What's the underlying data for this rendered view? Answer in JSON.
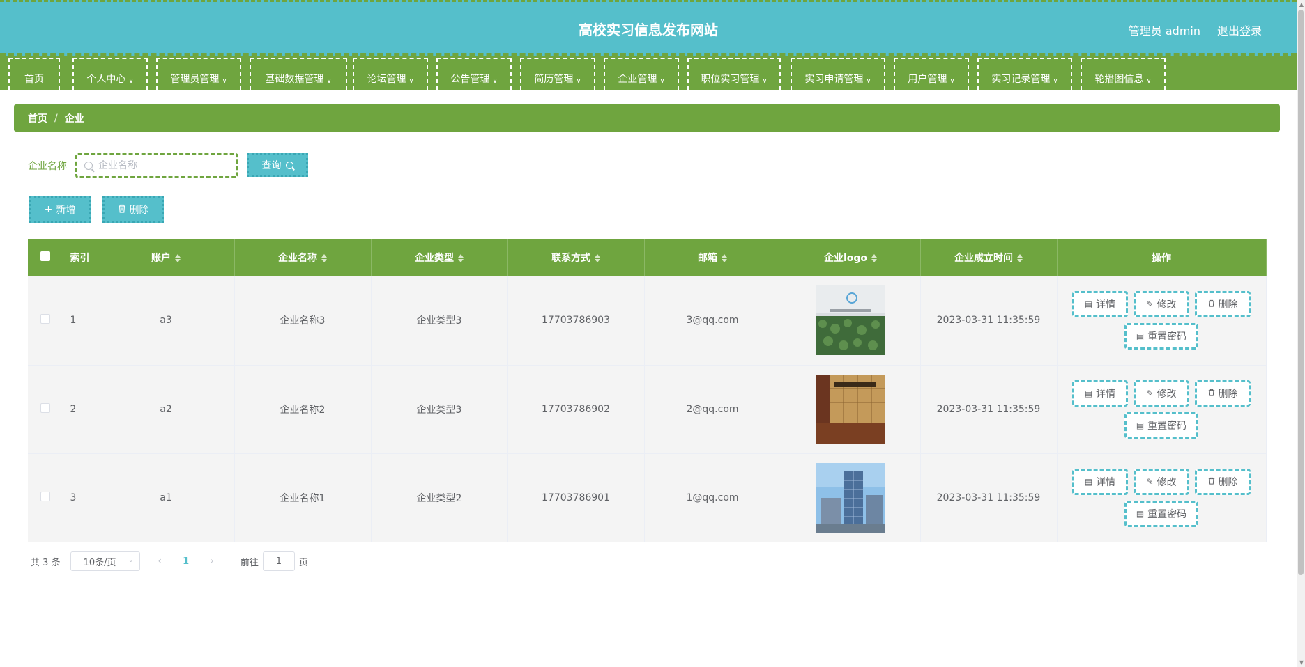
{
  "header": {
    "title": "高校实习信息发布网站",
    "admin_label": "管理员 admin",
    "logout_label": "退出登录",
    "bg_color": "#55bfcb",
    "accent_color": "#6fa53f"
  },
  "nav": {
    "items": [
      {
        "label": "首页",
        "has_dropdown": false
      },
      {
        "label": "个人中心",
        "has_dropdown": true
      },
      {
        "label": "管理员管理",
        "has_dropdown": true
      },
      {
        "label": "基础数据管理",
        "has_dropdown": true
      },
      {
        "label": "论坛管理",
        "has_dropdown": true
      },
      {
        "label": "公告管理",
        "has_dropdown": true
      },
      {
        "label": "简历管理",
        "has_dropdown": true
      },
      {
        "label": "企业管理",
        "has_dropdown": true
      },
      {
        "label": "职位实习管理",
        "has_dropdown": true
      },
      {
        "label": "实习申请管理",
        "has_dropdown": true
      },
      {
        "label": "用户管理",
        "has_dropdown": true
      },
      {
        "label": "实习记录管理",
        "has_dropdown": true
      },
      {
        "label": "轮播图信息",
        "has_dropdown": true
      }
    ]
  },
  "breadcrumb": {
    "home": "首页",
    "separator": "/",
    "current": "企业"
  },
  "search": {
    "label": "企业名称",
    "placeholder": "企业名称",
    "value": "",
    "query_label": "查询"
  },
  "toolbar": {
    "add_label": "新增",
    "delete_label": "删除"
  },
  "table": {
    "headers": {
      "index": "索引",
      "account": "账户",
      "name": "企业名称",
      "type": "企业类型",
      "phone": "联系方式",
      "email": "邮箱",
      "logo": "企业logo",
      "founded": "企业成立时间",
      "actions": "操作"
    },
    "rows": [
      {
        "index": "1",
        "account": "a3",
        "name": "企业名称3",
        "type": "企业类型3",
        "phone": "17703786903",
        "email": "3@qq.com",
        "logo": "office-green-wall-photo",
        "founded": "2023-03-31 11:35:59"
      },
      {
        "index": "2",
        "account": "a2",
        "name": "企业名称2",
        "type": "企业类型3",
        "phone": "17703786902",
        "email": "2@qq.com",
        "logo": "office-wood-reception-photo",
        "founded": "2023-03-31 11:35:59"
      },
      {
        "index": "3",
        "account": "a1",
        "name": "企业名称1",
        "type": "企业类型2",
        "phone": "17703786901",
        "email": "1@qq.com",
        "logo": "office-tower-photo",
        "founded": "2023-03-31 11:35:59"
      }
    ],
    "row_actions": {
      "detail": "详情",
      "edit": "修改",
      "delete": "删除",
      "reset_password": "重置密码"
    }
  },
  "pagination": {
    "total_text": "共 3 条",
    "page_size": "10条/页",
    "current_page": "1",
    "goto_prefix": "前往",
    "goto_value": "1",
    "goto_suffix": "页"
  }
}
